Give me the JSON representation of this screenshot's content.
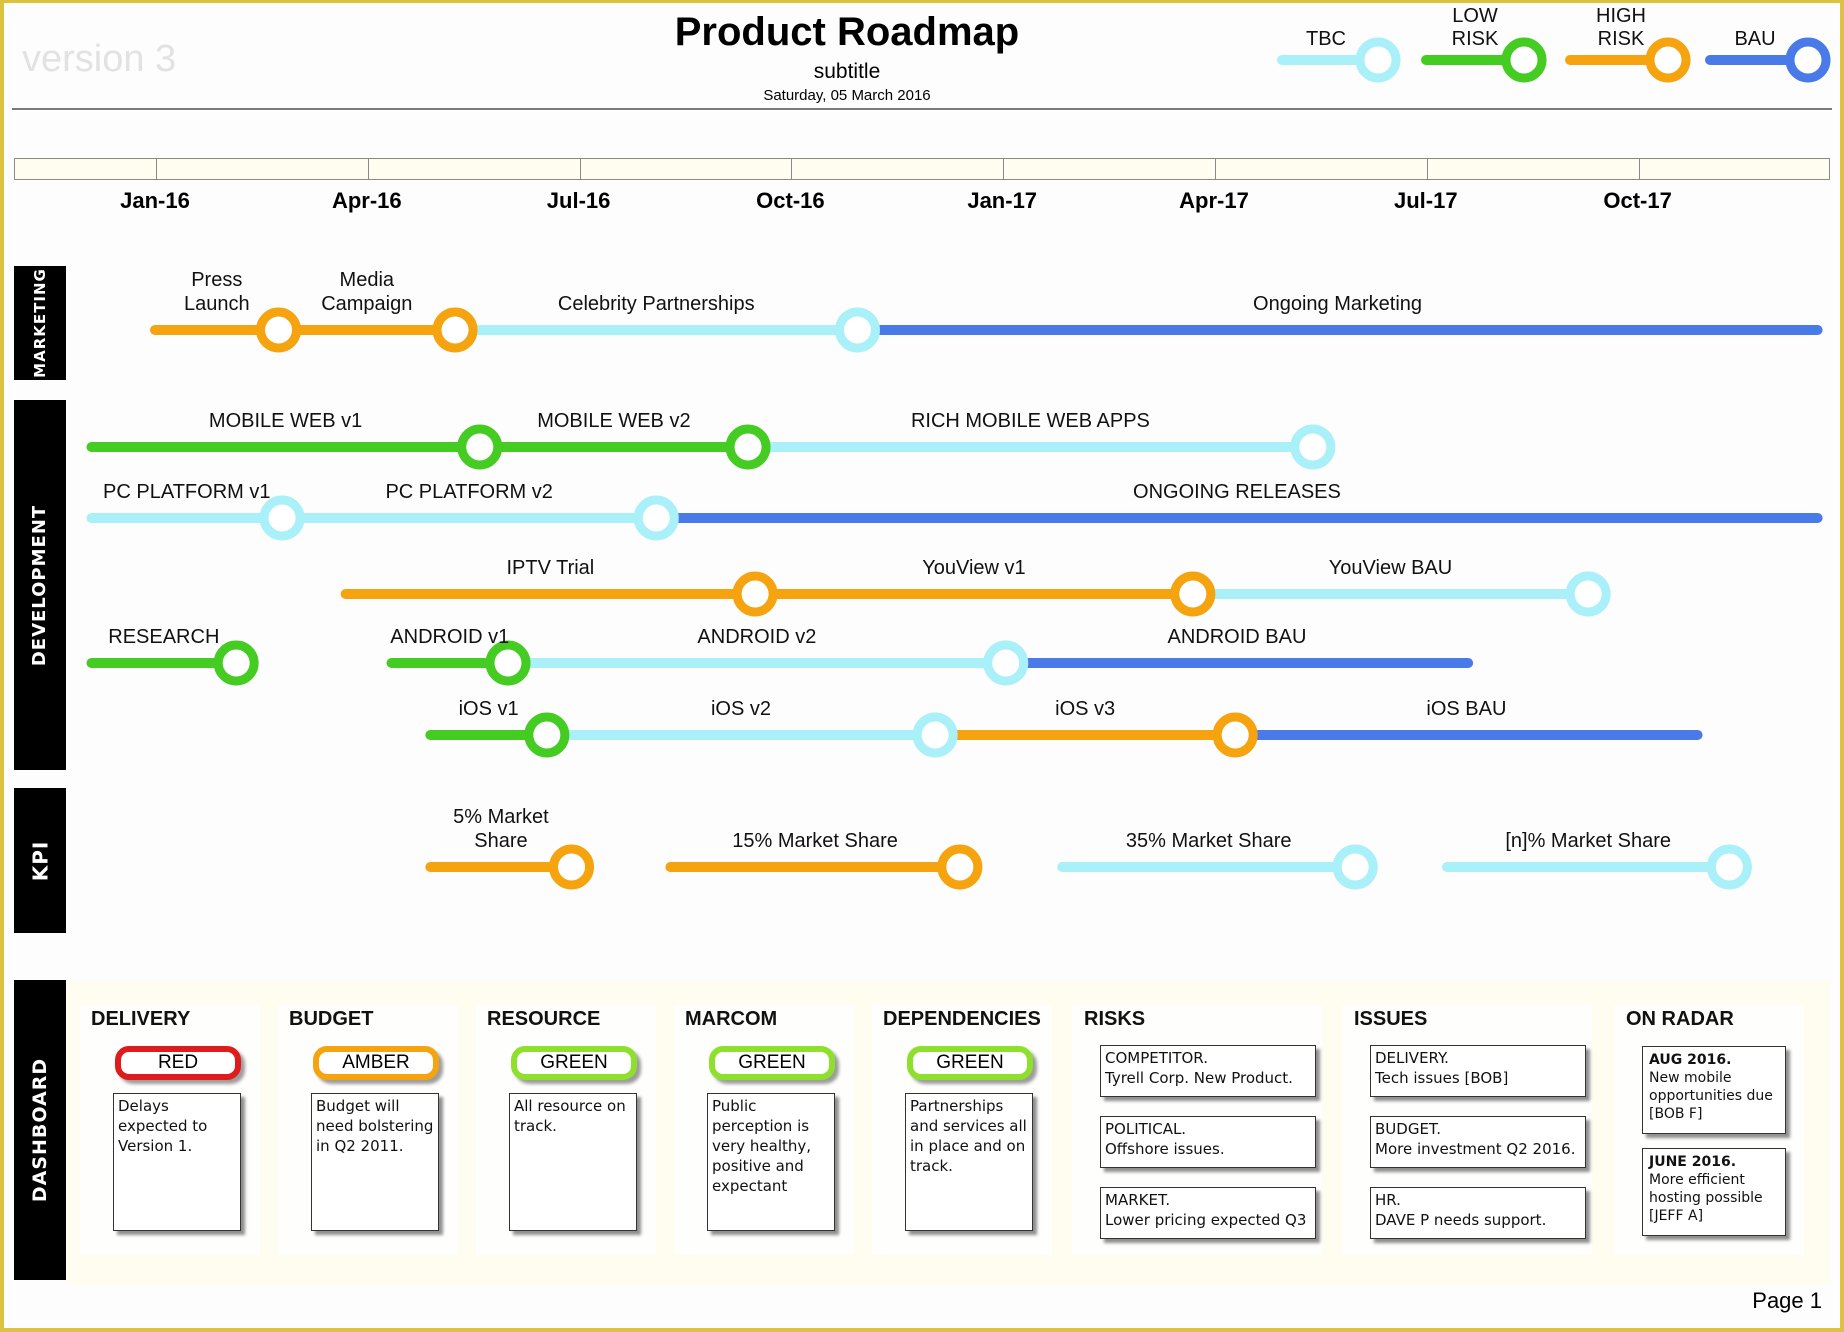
{
  "header": {
    "watermark": "version 3",
    "title": "Product Roadmap",
    "subtitle": "subtitle",
    "date": "Saturday, 05 March 2016"
  },
  "legend": [
    {
      "key": "tbc",
      "label_line1": "",
      "label_line2": "TBC",
      "color": "#a9f0f8"
    },
    {
      "key": "low-risk",
      "label_line1": "LOW",
      "label_line2": "RISK",
      "color": "#44cc22"
    },
    {
      "key": "high-risk",
      "label_line1": "HIGH",
      "label_line2": "RISK",
      "color": "#f5a30f"
    },
    {
      "key": "bau",
      "label_line1": "",
      "label_line2": "BAU",
      "color": "#4a7ae8"
    }
  ],
  "colors": {
    "tbc": "#a9f0f8",
    "low": "#44cc22",
    "high": "#f5a30f",
    "bau": "#4a7ae8",
    "rag_red": "#e01b1b",
    "rag_amber": "#f5a30f",
    "rag_green": "#8fe02c"
  },
  "timeline": {
    "start": "2015-11",
    "end": "2018-01",
    "ticks": [
      "Jan-16",
      "Apr-16",
      "Jul-16",
      "Oct-16",
      "Jan-17",
      "Apr-17",
      "Jul-17",
      "Oct-17"
    ]
  },
  "sections": [
    {
      "key": "marketing",
      "label": "MARKETING"
    },
    {
      "key": "development",
      "label": "DEVELOPMENT"
    },
    {
      "key": "kpi",
      "label": "KPI"
    },
    {
      "key": "dashboard",
      "label": "DASHBOARD"
    }
  ],
  "chart_data": {
    "type": "roadmap",
    "time_unit": "months since Dec-2015 (Jan-16 = 1)",
    "lanes": [
      {
        "section": "marketing",
        "segments": [
          {
            "label": "Press Launch",
            "start": 1.0,
            "end": 2.75,
            "status": "high",
            "milestone": true
          },
          {
            "label": "Media Campaign",
            "start": 2.75,
            "end": 5.25,
            "status": "high",
            "milestone": true
          },
          {
            "label": "Celebrity Partnerships",
            "start": 5.25,
            "end": 10.95,
            "status": "tbc",
            "milestone": true
          },
          {
            "label": "Ongoing Marketing",
            "start": 10.95,
            "end": 24.55,
            "status": "bau",
            "milestone": false
          }
        ]
      },
      {
        "section": "development",
        "segments": [
          {
            "label": "MOBILE WEB v1",
            "start": 0.1,
            "end": 5.6,
            "status": "low",
            "milestone": true
          },
          {
            "label": "MOBILE WEB v2",
            "start": 5.6,
            "end": 9.4,
            "status": "low",
            "milestone": true
          },
          {
            "label": "RICH MOBILE WEB APPS",
            "start": 9.4,
            "end": 17.4,
            "status": "tbc",
            "milestone": true
          }
        ]
      },
      {
        "section": "development",
        "segments": [
          {
            "label": "PC PLATFORM v1",
            "start": 0.1,
            "end": 2.8,
            "status": "tbc",
            "milestone": true
          },
          {
            "label": "PC PLATFORM v2",
            "start": 2.8,
            "end": 8.1,
            "status": "tbc",
            "milestone": true
          },
          {
            "label": "ONGOING RELEASES",
            "start": 8.1,
            "end": 24.55,
            "status": "bau",
            "milestone": false
          }
        ]
      },
      {
        "section": "development",
        "segments": [
          {
            "label": "IPTV Trial",
            "start": 3.7,
            "end": 9.5,
            "status": "high",
            "milestone": true
          },
          {
            "label": "YouView v1",
            "start": 9.5,
            "end": 15.7,
            "status": "high",
            "milestone": true
          },
          {
            "label": "YouView BAU",
            "start": 15.7,
            "end": 21.3,
            "status": "tbc",
            "milestone": true
          }
        ]
      },
      {
        "section": "development",
        "segments": [
          {
            "label": "RESEARCH",
            "start": 0.1,
            "end": 2.15,
            "status": "low",
            "milestone": true
          },
          {
            "label": "ANDROID v1",
            "start": 4.35,
            "end": 6.0,
            "status": "low",
            "milestone": true
          },
          {
            "label": "ANDROID v2",
            "start": 6.0,
            "end": 13.05,
            "status": "tbc",
            "milestone": true
          },
          {
            "label": "ANDROID BAU",
            "start": 13.05,
            "end": 19.6,
            "status": "bau",
            "milestone": false
          }
        ]
      },
      {
        "section": "development",
        "segments": [
          {
            "label": "iOS v1",
            "start": 4.9,
            "end": 6.55,
            "status": "low",
            "milestone": true
          },
          {
            "label": "iOS v2",
            "start": 6.55,
            "end": 12.05,
            "status": "tbc",
            "milestone": true
          },
          {
            "label": "iOS v3",
            "start": 12.05,
            "end": 16.3,
            "status": "high",
            "milestone": true
          },
          {
            "label": "iOS BAU",
            "start": 16.3,
            "end": 22.85,
            "status": "bau",
            "milestone": false
          }
        ]
      },
      {
        "section": "kpi",
        "segments": [
          {
            "label": "5% Market Share",
            "start": 4.9,
            "end": 6.9,
            "status": "high",
            "milestone": true
          },
          {
            "label": "15% Market Share",
            "start": 8.3,
            "end": 12.4,
            "status": "high",
            "milestone": true
          },
          {
            "label": "35% Market Share",
            "start": 13.85,
            "end": 18.0,
            "status": "tbc",
            "milestone": true
          },
          {
            "label": "[n]% Market Share",
            "start": 19.3,
            "end": 23.3,
            "status": "tbc",
            "milestone": true
          }
        ]
      }
    ]
  },
  "dashboard": {
    "rag_columns": [
      {
        "heading": "DELIVERY",
        "status": "RED",
        "status_key": "rag_red",
        "note": "Delays expected to Version 1."
      },
      {
        "heading": "BUDGET",
        "status": "AMBER",
        "status_key": "rag_amber",
        "note": "Budget will need bolstering in Q2 2011."
      },
      {
        "heading": "RESOURCE",
        "status": "GREEN",
        "status_key": "rag_green",
        "note": "All resource on track."
      },
      {
        "heading": "MARCOM",
        "status": "GREEN",
        "status_key": "rag_green",
        "note": "Public perception is very healthy, positive and expectant"
      },
      {
        "heading": "DEPENDENCIES",
        "status": "GREEN",
        "status_key": "rag_green",
        "note": "Partnerships and services all in place and on track."
      }
    ],
    "risks": {
      "heading": "RISKS",
      "items": [
        {
          "title": "COMPETITOR.",
          "text": "Tyrell Corp. New Product."
        },
        {
          "title": "POLITICAL.",
          "text": "Offshore issues."
        },
        {
          "title": "MARKET.",
          "text": "Lower pricing expected Q3"
        }
      ]
    },
    "issues": {
      "heading": "ISSUES",
      "items": [
        {
          "title": "DELIVERY.",
          "text": "Tech issues [BOB]"
        },
        {
          "title": "BUDGET.",
          "text": "More investment Q2 2016."
        },
        {
          "title": "HR.",
          "text": "DAVE P needs support."
        }
      ]
    },
    "on_radar": {
      "heading": "ON RADAR",
      "items": [
        {
          "title": "AUG 2016.",
          "text": "New mobile opportunities due [BOB F]"
        },
        {
          "title": "JUNE 2016.",
          "text": "More efficient hosting possible [JEFF A]"
        }
      ]
    }
  },
  "footer": {
    "page": "Page 1"
  }
}
